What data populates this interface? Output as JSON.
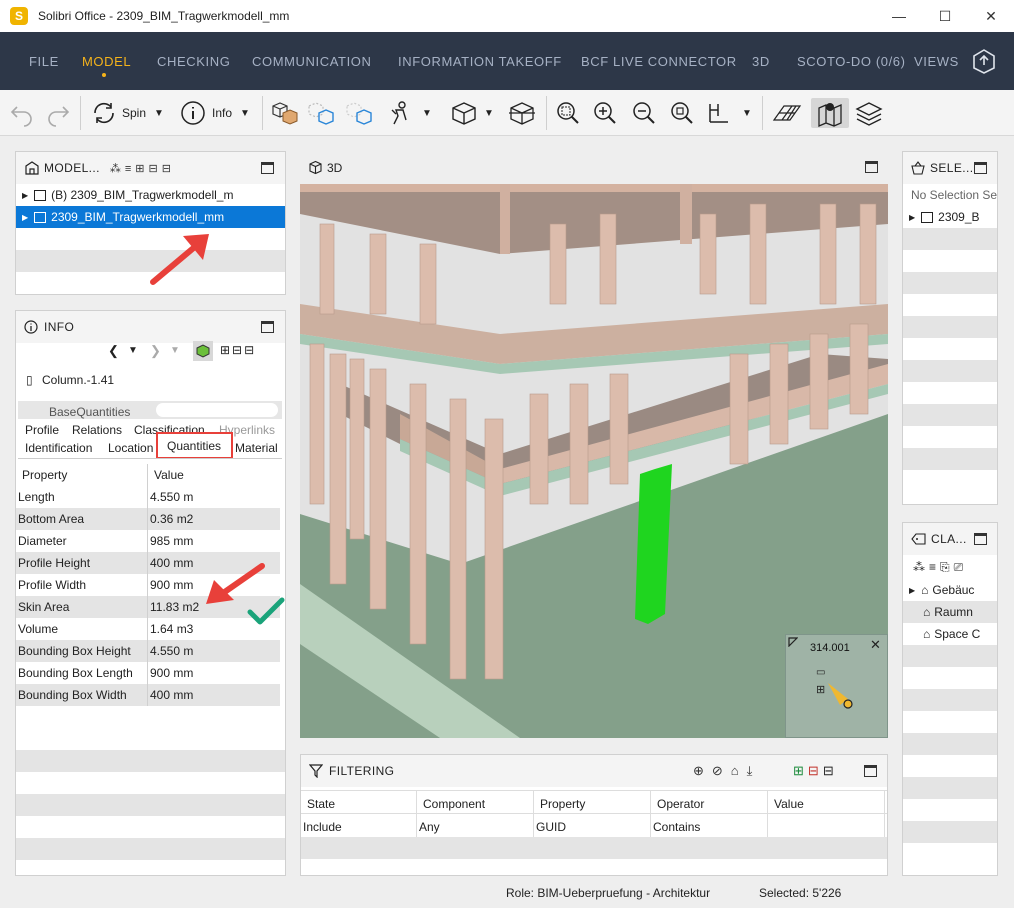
{
  "window": {
    "title": "Solibri Office - 2309_BIM_Tragwerkmodell_mm",
    "app_letter": "S"
  },
  "menu": {
    "items": [
      "FILE",
      "MODEL",
      "CHECKING",
      "COMMUNICATION",
      "INFORMATION TAKEOFF",
      "BCF LIVE CONNECTOR",
      "3D",
      "SCOTO-DO (0/6)",
      "VIEWS"
    ],
    "active": "MODEL",
    "accent": "#f5b31b",
    "background": "#2d3748"
  },
  "toolbar": {
    "spin_label": "Spin",
    "info_label": "Info"
  },
  "model_panel": {
    "title": "MODEL...",
    "items": [
      {
        "label": "(B) 2309_BIM_Tragwerkmodell_m",
        "selected": false
      },
      {
        "label": "2309_BIM_Tragwerkmodell_mm",
        "selected": true
      }
    ],
    "selection_color": "#0b78d7"
  },
  "info_panel": {
    "title": "INFO",
    "object_name": "Column.-1.41",
    "tabs_row1": [
      "BaseQuantities"
    ],
    "tabs_row2": [
      "Profile",
      "Relations",
      "Classification",
      "Hyperlinks"
    ],
    "tabs_row3": [
      "Identification",
      "Location",
      "Quantities",
      "Material"
    ],
    "active_tab": "Quantities",
    "columns": [
      "Property",
      "Value"
    ],
    "rows": [
      {
        "property": "Length",
        "value": "4.550 m"
      },
      {
        "property": "Bottom Area",
        "value": "0.36 m2"
      },
      {
        "property": "Diameter",
        "value": "985 mm"
      },
      {
        "property": "Profile Height",
        "value": "400 mm"
      },
      {
        "property": "Profile Width",
        "value": "900 mm"
      },
      {
        "property": "Skin Area",
        "value": "11.83 m2"
      },
      {
        "property": "Volume",
        "value": "1.64 m3"
      },
      {
        "property": "Bounding Box Height",
        "value": "4.550 m"
      },
      {
        "property": "Bounding Box Length",
        "value": "900 mm"
      },
      {
        "property": "Bounding Box Width",
        "value": "400 mm"
      }
    ]
  },
  "view3d": {
    "title": "3D",
    "compass_value": "314.001",
    "highlight_color": "#1fd51f"
  },
  "selection_panel": {
    "title": "SELE...",
    "placeholder": "No Selection Se",
    "items": [
      "2309_B"
    ]
  },
  "classification_panel": {
    "title": "CLA...",
    "items": [
      "Gebäuc",
      "Raumn",
      "Space C"
    ]
  },
  "filtering": {
    "title": "FILTERING",
    "columns": [
      "State",
      "Component",
      "Property",
      "Operator",
      "Value"
    ],
    "rows": [
      [
        "Include",
        "Any",
        "GUID",
        "Contains",
        ""
      ]
    ]
  },
  "status": {
    "role": "Role: BIM-Ueberpruefung - Architektur",
    "selected": "Selected: 5'226"
  },
  "annotations": {
    "arrow_color": "#e8403a",
    "check_color": "#1aa37a",
    "box_color": "#e8403a"
  }
}
